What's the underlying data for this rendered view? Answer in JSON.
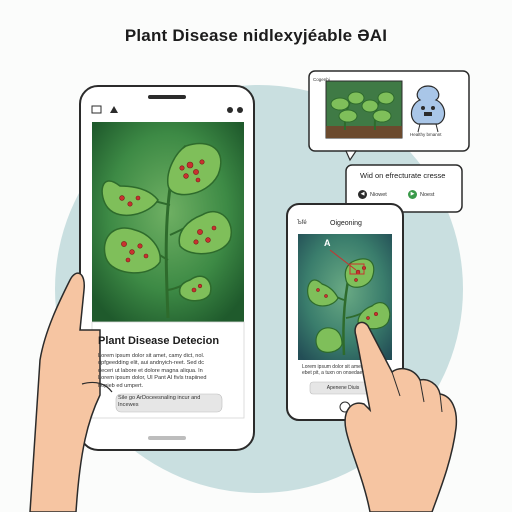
{
  "header": {
    "title": "Plant Disease nidlexyjéable ƏAI"
  },
  "phone_left": {
    "card_title": "Plant Disease Detecion",
    "body_lines": [
      "Lorem ipsum dolor sit amet, camy dict, nol.",
      "dpfgeedding elit, aui andnyich-reet. Sed dc",
      "deceri ut labore et dolore magna aliqua. In",
      "Lorem ipsum dolor, UI Pant AI fivls trapiined",
      "nopieb ed umpert."
    ],
    "button_lines": [
      "Sile go ArDoceesnaling incur and",
      "Incewes"
    ]
  },
  "bubble_top": {
    "small_label": "Cogenbi",
    "caption": "Healthy bmannt"
  },
  "bubble_mid": {
    "title": "Wid on efrecturate cresse",
    "left_label": "Niowet",
    "right_label": "Noest"
  },
  "phone_right": {
    "status_left": "Ъfé",
    "header": "Oigeoning",
    "annotation": "A",
    "body_lines": [
      "Lorem ipsum dolor sit amet",
      "ebet pit, a tuxn on onsedaet"
    ],
    "button": "Apenene Diuis"
  },
  "colors": {
    "leaf": "#7fbf5a",
    "leaf_dark": "#2e6b2c",
    "spot": "#c8322f",
    "bg_circle": "#c9dfe0",
    "skin": "#f6c5a2"
  }
}
